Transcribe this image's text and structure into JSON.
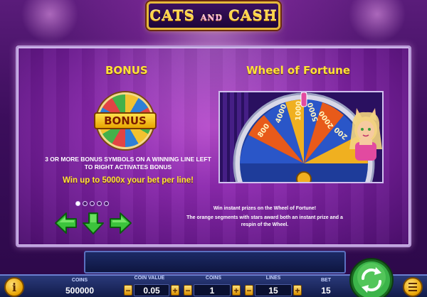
{
  "game": {
    "logo_main": "CATS",
    "logo_and": "AND",
    "logo_cash": "CASH"
  },
  "bonus_section": {
    "title": "BONUS",
    "badge_label": "BONUS",
    "description_line1": "3 OR MORE BONUS SYMBOLS ON A WINNING LINE LEFT",
    "description_line2": "TO RIGHT ACTIVATES BONUS",
    "win_text": "Win up to 5000x your bet per line!"
  },
  "wheel_section": {
    "title": "Wheel of Fortune",
    "wheel_values": [
      "800",
      "4000",
      "1000",
      "5000",
      "2000",
      "200"
    ],
    "desc_line1": "Win instant prizes on the Wheel of Fortune!",
    "desc_line2": "The orange segments with stars award both an instant prize and a",
    "desc_line3": "respin of the Wheel."
  },
  "pager": {
    "pages": 5,
    "active_index": 0
  },
  "controls": {
    "info_label": "i",
    "coins_label": "COINS",
    "coins_value": "500000",
    "coin_value_label": "COIN VALUE",
    "coin_value": "0.05",
    "coins_per_line_label": "COINS",
    "coins_per_line": "1",
    "lines_label": "LINES",
    "lines_value": "15",
    "bet_label": "BET",
    "bet_value": "15",
    "minus": "−",
    "plus": "+"
  },
  "colors": {
    "accent_yellow": "#ffe23a",
    "panel_purple": "#8e2ab0",
    "control_gold": "#e8a200",
    "spin_green": "#3cb44a"
  }
}
